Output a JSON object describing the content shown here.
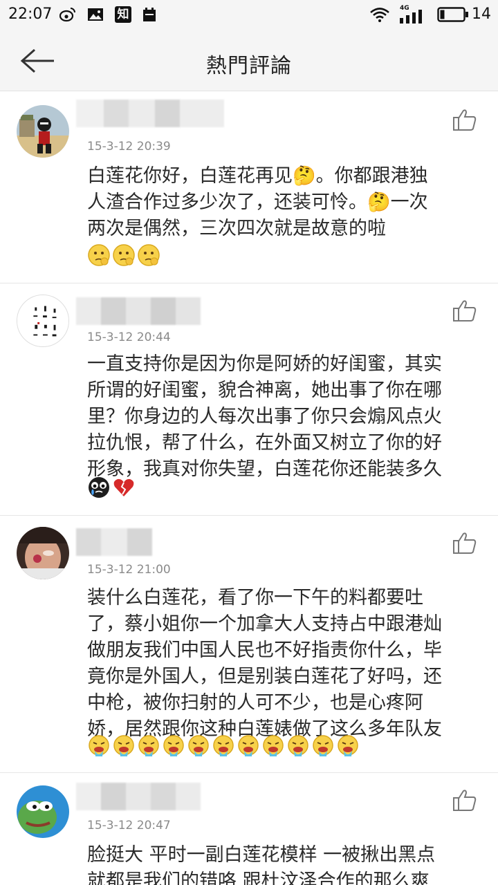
{
  "status_bar": {
    "time": "22:07",
    "network": "4G",
    "battery": "14",
    "icons": [
      "weibo-icon",
      "image-icon",
      "zhihu-icon",
      "calendar-icon",
      "wifi-icon",
      "signal-icon",
      "battery-icon"
    ],
    "zhihu_label": "知"
  },
  "header": {
    "title": "熱門評論",
    "back_icon": "back-arrow-icon"
  },
  "comments": [
    {
      "date": "15-3-12 20:39",
      "text_lines": [
        "白莲花你好，白莲花再见🤔。你都跟港独",
        "人渣合作过多少次了，还装可怜。🤔一次",
        "两次是偶然，三次四次就是故意的啦"
      ],
      "emojis": [
        "thinking-emoji",
        "thinking-emoji",
        "thinking-emoji"
      ]
    },
    {
      "date": "15-3-12 20:44",
      "text_lines": [
        "一直支持你是因为你是阿娇的好闺蜜，其实",
        "所谓的好闺蜜，貌合神离，她出事了你在哪",
        "里？你身边的人每次出事了你只会煽风点火",
        "拉仇恨，帮了什么，在外面又树立了你的好",
        "形象，我真对你失望，白莲花你还能装多久"
      ],
      "emojis": [
        "crying-face-emoji",
        "broken-heart-emoji"
      ]
    },
    {
      "date": "15-3-12 21:00",
      "text_lines": [
        "装什么白莲花，看了你一下午的料都要吐",
        "了，蔡小姐你一个加拿大人支持占中跟港灿",
        "做朋友我们中国人民也不好指责你什么，毕",
        "竟你是外国人，但是别装白莲花了好吗，还",
        "中枪，被你扫射的人可不少，也是心疼阿",
        "娇，居然跟你这种白莲婊做了这么多年队友"
      ],
      "emojis": [
        "vomit-emoji",
        "vomit-emoji",
        "vomit-emoji",
        "vomit-emoji",
        "vomit-emoji",
        "vomit-emoji",
        "vomit-emoji",
        "vomit-emoji",
        "vomit-emoji",
        "vomit-emoji",
        "vomit-emoji"
      ]
    },
    {
      "date": "15-3-12 20:47",
      "text_lines": [
        "脸挺大 平时一副白莲花模样 一被揪出黑点",
        "就都是我们的错咯 跟杜汶泽合作的那么爽"
      ],
      "emojis": []
    }
  ],
  "colors": {
    "background": "#ffffff",
    "header_bg": "#f5f5f5",
    "date_text": "#8a8a8a",
    "body_text": "#2a2a2a",
    "divider": "#e6e6e6"
  }
}
